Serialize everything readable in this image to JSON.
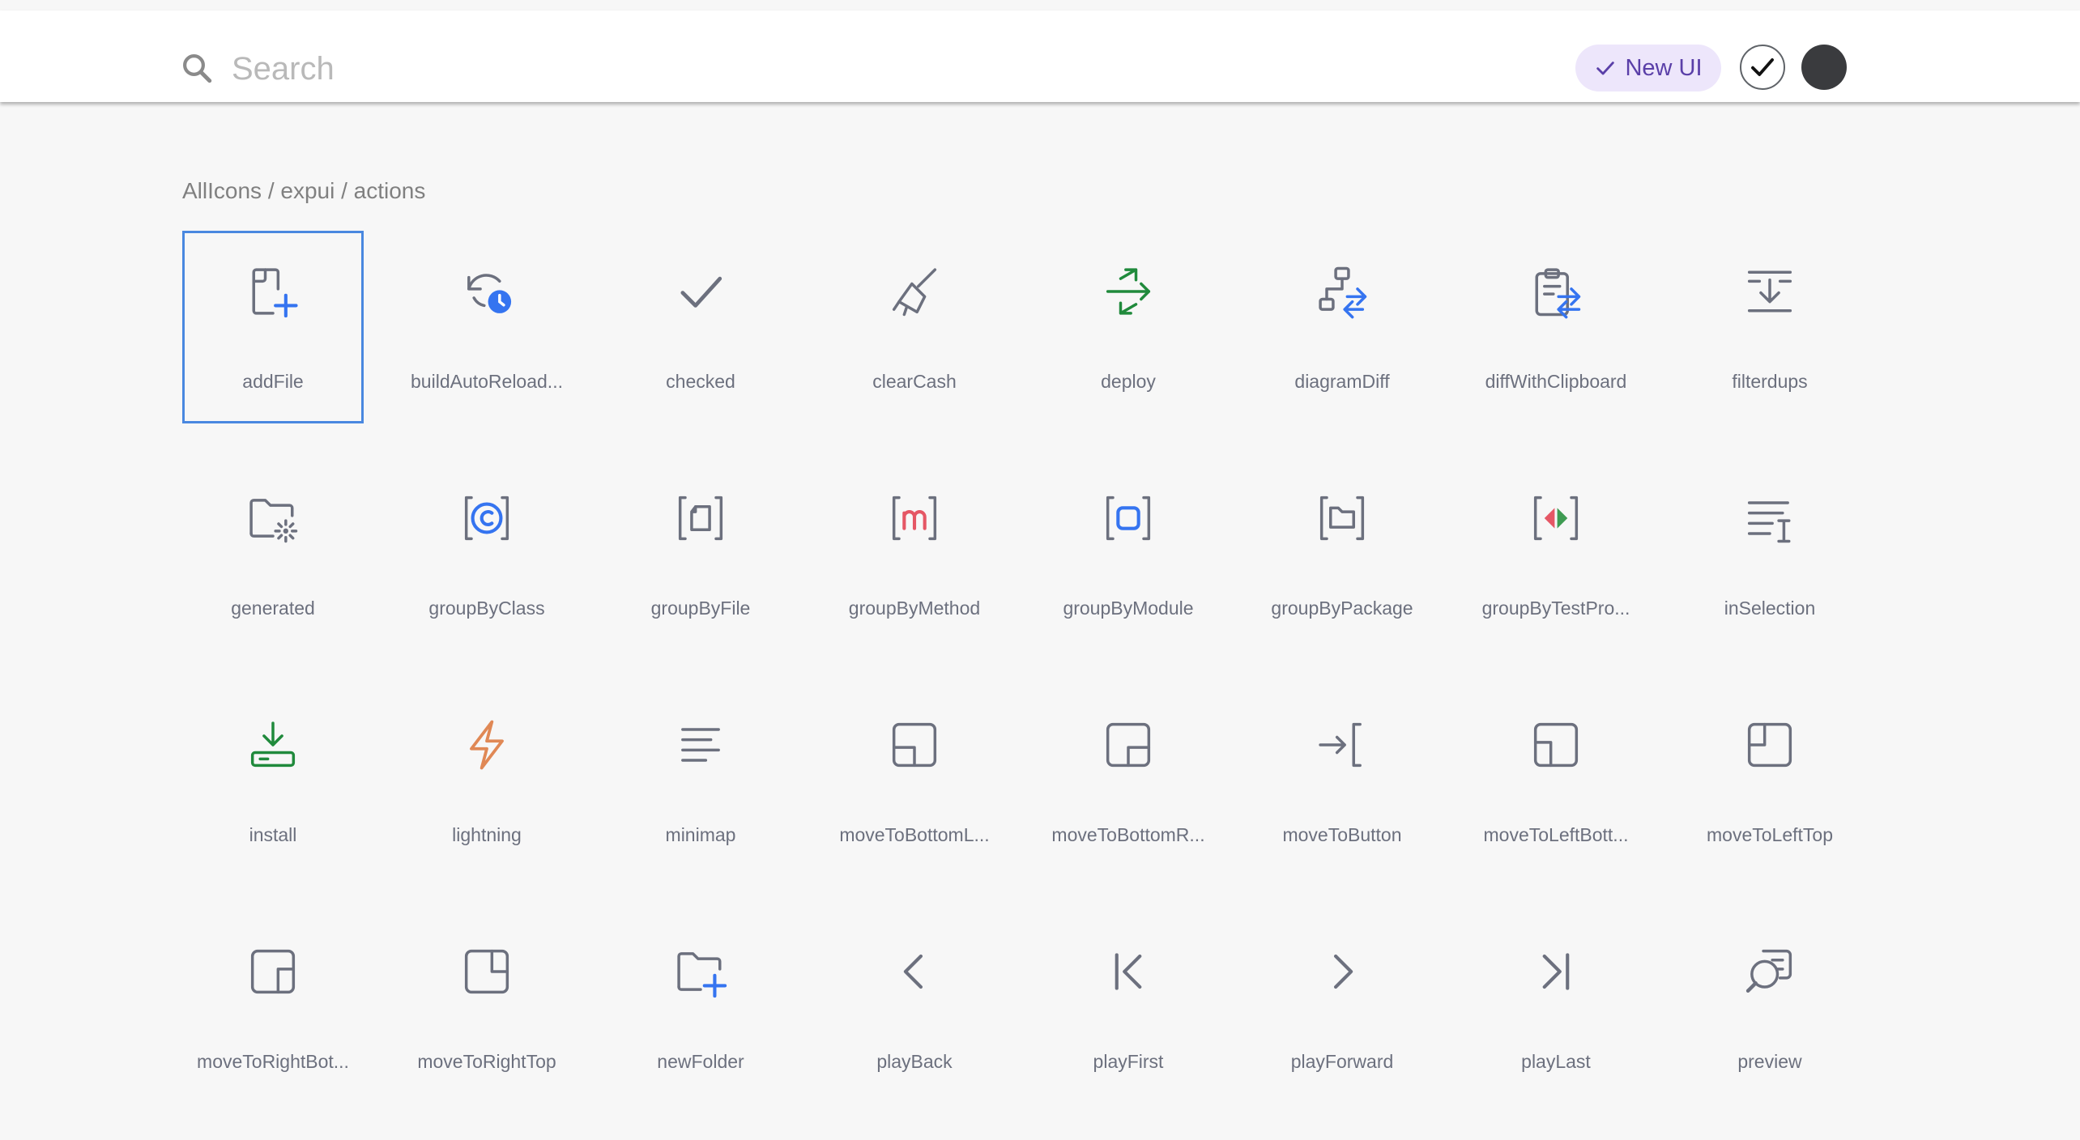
{
  "search": {
    "placeholder": "Search"
  },
  "header": {
    "new_ui_label": "New UI"
  },
  "breadcrumb": "AllIcons / expui / actions",
  "colors": {
    "icon_gray": "#6c707e",
    "blue": "#3574f0",
    "green": "#208a3c",
    "red": "#e55765",
    "orange": "#e08855",
    "selection": "#4a88e0",
    "pill_bg": "#ede6fb",
    "pill_text": "#5a3fa8"
  },
  "icons": [
    {
      "label": "addFile",
      "icon": "add-file-icon",
      "selected": true
    },
    {
      "label": "buildAutoReload...",
      "icon": "build-auto-reload-icon"
    },
    {
      "label": "checked",
      "icon": "checked-icon"
    },
    {
      "label": "clearCash",
      "icon": "clear-cash-icon"
    },
    {
      "label": "deploy",
      "icon": "deploy-icon"
    },
    {
      "label": "diagramDiff",
      "icon": "diagram-diff-icon"
    },
    {
      "label": "diffWithClipboard",
      "icon": "diff-with-clipboard-icon"
    },
    {
      "label": "filterdups",
      "icon": "filterdups-icon"
    },
    {
      "label": "generated",
      "icon": "generated-icon"
    },
    {
      "label": "groupByClass",
      "icon": "group-by-class-icon"
    },
    {
      "label": "groupByFile",
      "icon": "group-by-file-icon"
    },
    {
      "label": "groupByMethod",
      "icon": "group-by-method-icon"
    },
    {
      "label": "groupByModule",
      "icon": "group-by-module-icon"
    },
    {
      "label": "groupByPackage",
      "icon": "group-by-package-icon"
    },
    {
      "label": "groupByTestPro...",
      "icon": "group-by-test-production-icon"
    },
    {
      "label": "inSelection",
      "icon": "in-selection-icon"
    },
    {
      "label": "install",
      "icon": "install-icon"
    },
    {
      "label": "lightning",
      "icon": "lightning-icon"
    },
    {
      "label": "minimap",
      "icon": "minimap-icon"
    },
    {
      "label": "moveToBottomL...",
      "icon": "move-to-bottom-left-icon"
    },
    {
      "label": "moveToBottomR...",
      "icon": "move-to-bottom-right-icon"
    },
    {
      "label": "moveToButton",
      "icon": "move-to-button-icon"
    },
    {
      "label": "moveToLeftBott...",
      "icon": "move-to-left-bottom-icon"
    },
    {
      "label": "moveToLeftTop",
      "icon": "move-to-left-top-icon"
    },
    {
      "label": "moveToRightBot...",
      "icon": "move-to-right-bottom-icon"
    },
    {
      "label": "moveToRightTop",
      "icon": "move-to-right-top-icon"
    },
    {
      "label": "newFolder",
      "icon": "new-folder-icon"
    },
    {
      "label": "playBack",
      "icon": "play-back-icon"
    },
    {
      "label": "playFirst",
      "icon": "play-first-icon"
    },
    {
      "label": "playForward",
      "icon": "play-forward-icon"
    },
    {
      "label": "playLast",
      "icon": "play-last-icon"
    },
    {
      "label": "preview",
      "icon": "preview-icon"
    }
  ]
}
